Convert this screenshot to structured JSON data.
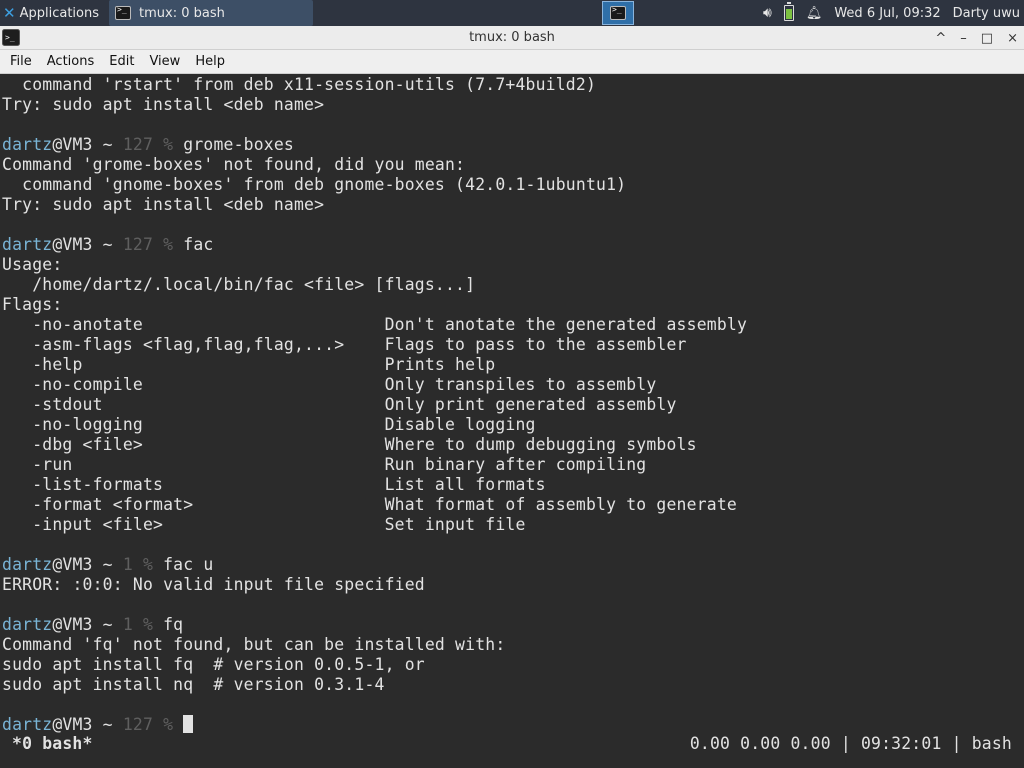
{
  "panel": {
    "applications_label": "Applications",
    "task_label": "tmux: 0 bash",
    "clock": "Wed  6 Jul, 09:32",
    "user": "Darty uwu"
  },
  "window": {
    "title": "tmux: 0 bash",
    "controls": [
      "^",
      "–",
      "□",
      "×"
    ]
  },
  "menubar": [
    "File",
    "Actions",
    "Edit",
    "View",
    "Help"
  ],
  "terminal": {
    "prompt_user": "dartz",
    "prompt_host": "@VM3 ~ ",
    "lines": {
      "l0": "  command 'rstart' from deb x11-session-utils (7.7+4build2)",
      "l1": "Try: sudo apt install <deb name>",
      "l3_code": "127 % ",
      "l3_cmd": "grome-boxes",
      "l4": "Command 'grome-boxes' not found, did you mean:",
      "l5": "  command 'gnome-boxes' from deb gnome-boxes (42.0.1-1ubuntu1)",
      "l6": "Try: sudo apt install <deb name>",
      "l8_code": "127 % ",
      "l8_cmd": "fac",
      "l9": "Usage:",
      "l10": "   /home/dartz/.local/bin/fac <file> [flags...]",
      "l11": "Flags:",
      "l12": "   -no-anotate                        Don't anotate the generated assembly",
      "l13": "   -asm-flags <flag,flag,flag,...>    Flags to pass to the assembler",
      "l14": "   -help                              Prints help",
      "l15": "   -no-compile                        Only transpiles to assembly",
      "l16": "   -stdout                            Only print generated assembly",
      "l17": "   -no-logging                        Disable logging",
      "l18": "   -dbg <file>                        Where to dump debugging symbols",
      "l19": "   -run                               Run binary after compiling",
      "l20": "   -list-formats                      List all formats",
      "l21": "   -format <format>                   What format of assembly to generate",
      "l22": "   -input <file>                      Set input file",
      "l24_code": "1 % ",
      "l24_cmd": "fac u",
      "l25": "ERROR: :0:0: No valid input file specified",
      "l27_code": "1 % ",
      "l27_cmd": "fq",
      "l28": "Command 'fq' not found, but can be installed with:",
      "l29": "sudo apt install fq  # version 0.0.5-1, or",
      "l30": "sudo apt install nq  # version 0.3.1-4",
      "l32_code": "127 % "
    }
  },
  "tmux_status": {
    "left": "*0 bash*",
    "right": "0.00 0.00 0.00 | 09:32:01 | bash"
  }
}
